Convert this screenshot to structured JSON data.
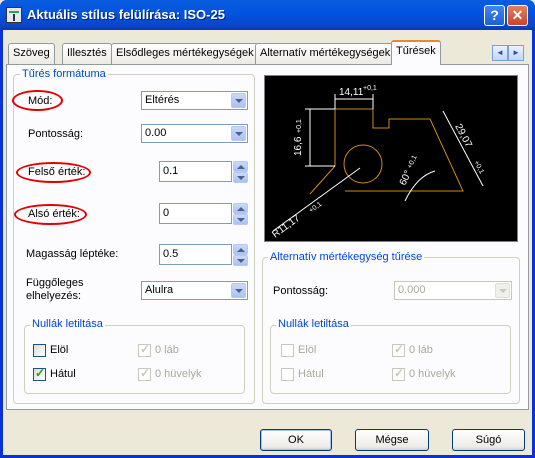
{
  "window": {
    "title": "Aktuális stílus felülírása: ISO-25",
    "help_label": "?",
    "close_label": "✕"
  },
  "tabs": [
    {
      "label": "Szöveg",
      "active": false
    },
    {
      "label": "Illesztés",
      "active": false
    },
    {
      "label": "Elsődleges mértékegységek",
      "active": false
    },
    {
      "label": "Alternatív mértékegységek",
      "active": false
    },
    {
      "label": "Tűrések",
      "active": true
    }
  ],
  "tab_scroll": {
    "left": "◄",
    "right": "►"
  },
  "tolerance_format": {
    "group_title": "Tűrés formátuma",
    "mode_label": "Mód:",
    "mode_value": "Eltérés",
    "precision_label": "Pontosság:",
    "precision_value": "0.00",
    "upper_label": "Felső érték:",
    "upper_value": "0.1",
    "lower_label": "Alsó érték:",
    "lower_value": "0",
    "height_scale_label": "Magasság léptéke:",
    "height_scale_value": "0.5",
    "vertical_pos_label_1": "Függőleges",
    "vertical_pos_label_2": "elhelyezés:",
    "vertical_pos_value": "Alulra"
  },
  "zero_suppress_left": {
    "group_title": "Nullák letiltása",
    "leading_label": "Elöl",
    "leading_checked": false,
    "trailing_label": "Hátul",
    "trailing_checked": true,
    "feet_label": "0 láb",
    "feet_checked": true,
    "inches_label": "0 hüvelyk",
    "inches_checked": true
  },
  "alt_tolerance": {
    "group_title": "Alternatív mértékegység tűrése",
    "precision_label": "Pontosság:",
    "precision_value": "0.000",
    "zero_group_title": "Nullák letiltása",
    "leading_label": "Elöl",
    "leading_checked": false,
    "trailing_label": "Hátul",
    "trailing_checked": false,
    "feet_label": "0 láb",
    "feet_checked": true,
    "inches_label": "0 hüvelyk",
    "inches_checked": true
  },
  "preview": {
    "dim_top": "14,11",
    "dim_top_tol": "+0,1",
    "dim_left": "16,6",
    "dim_left_tol": "+0,1",
    "dim_right": "29,07",
    "dim_right_tol": "+0,1",
    "dim_angle": "60°",
    "dim_angle_tol": "+0,1",
    "dim_radius": "R11,17",
    "dim_radius_tol": "+0,1"
  },
  "buttons": {
    "ok": "OK",
    "cancel": "Mégse",
    "help": "Súgó"
  },
  "colors": {
    "titlebar": "#0054e3",
    "group_title": "#0046d5",
    "highlight_ellipse": "#e30000",
    "preview_bg": "#000000",
    "preview_geometry": "#d08a1c",
    "preview_dims": "#ffffff"
  }
}
